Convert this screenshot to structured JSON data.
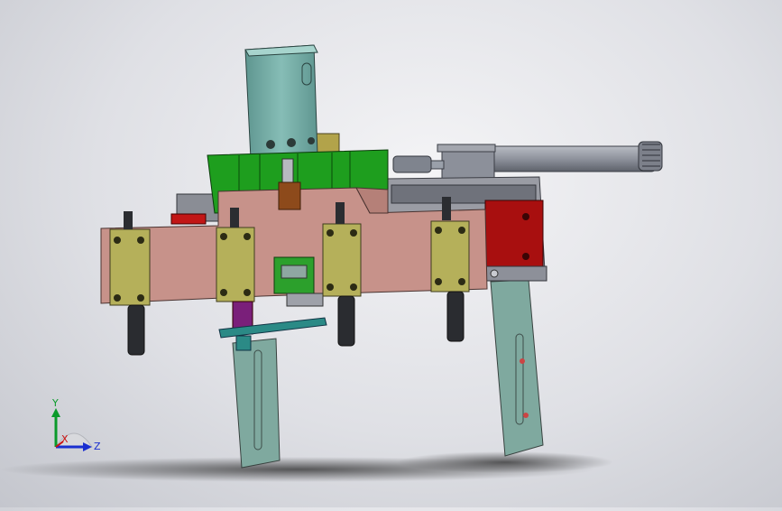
{
  "triad": {
    "y_label": "Y",
    "x_label": "X",
    "z_label": "Z",
    "colors": {
      "y": "#0a9a2a",
      "x": "#cc1111",
      "z": "#1a2fd0"
    }
  },
  "model": {
    "colors": {
      "main_plate": "#c99087",
      "green_block": "#1fa11f",
      "cylinder_teal": "#6fa6a0",
      "rail": "#7aa8a0",
      "clamp_blocks": "#b6b15a",
      "red_block": "#b01010",
      "rod": "#8a8f9a",
      "dark_grey": "#4a4d55",
      "background": "#e6e7eb"
    }
  }
}
